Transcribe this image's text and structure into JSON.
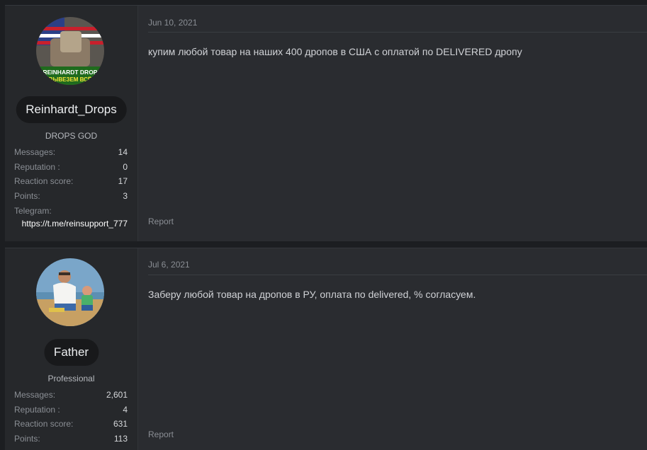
{
  "posts": [
    {
      "date": "Jun 10, 2021",
      "username": "Reinhardt_Drops",
      "user_title": "DROPS GOD",
      "avatar_text_line1": "REINHARDT DROP",
      "avatar_text_line2": "ВЫВЕЗЕМ ВСЁ",
      "stats": [
        {
          "label": "Messages:",
          "value": "14"
        },
        {
          "label": "Reputation :",
          "value": "0"
        },
        {
          "label": "Reaction score:",
          "value": "17"
        },
        {
          "label": "Points:",
          "value": "3"
        }
      ],
      "telegram_label": "Telegram:",
      "telegram_link": "https://t.me/reinsupport_777",
      "body": "купим любой товар на наших 400 дропов в США с оплатой по DELIVERED дропу",
      "report_label": "Report"
    },
    {
      "date": "Jul 6, 2021",
      "username": "Father",
      "user_title": "Professional",
      "stats": [
        {
          "label": "Messages:",
          "value": "2,601"
        },
        {
          "label": "Reputation :",
          "value": "4"
        },
        {
          "label": "Reaction score:",
          "value": "631"
        },
        {
          "label": "Points:",
          "value": "113"
        }
      ],
      "body": "Заберу любой товар на дропов в РУ, оплата по delivered, % согласуем.",
      "report_label": "Report"
    }
  ]
}
